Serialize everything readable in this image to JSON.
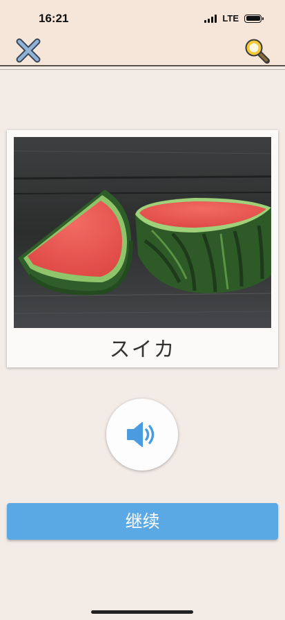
{
  "status_bar": {
    "time": "16:21",
    "network": "LTE"
  },
  "toolbar": {
    "close_icon": "close-x-icon",
    "search_icon": "magnifier-icon"
  },
  "flashcard": {
    "word": "スイカ",
    "image": "watermelon-photo"
  },
  "audio": {
    "icon": "speaker-icon"
  },
  "actions": {
    "continue_label": "继续"
  },
  "colors": {
    "accent": "#5aa8e4",
    "header_bg": "#f6e6da",
    "page_bg": "#f3ebe6"
  }
}
